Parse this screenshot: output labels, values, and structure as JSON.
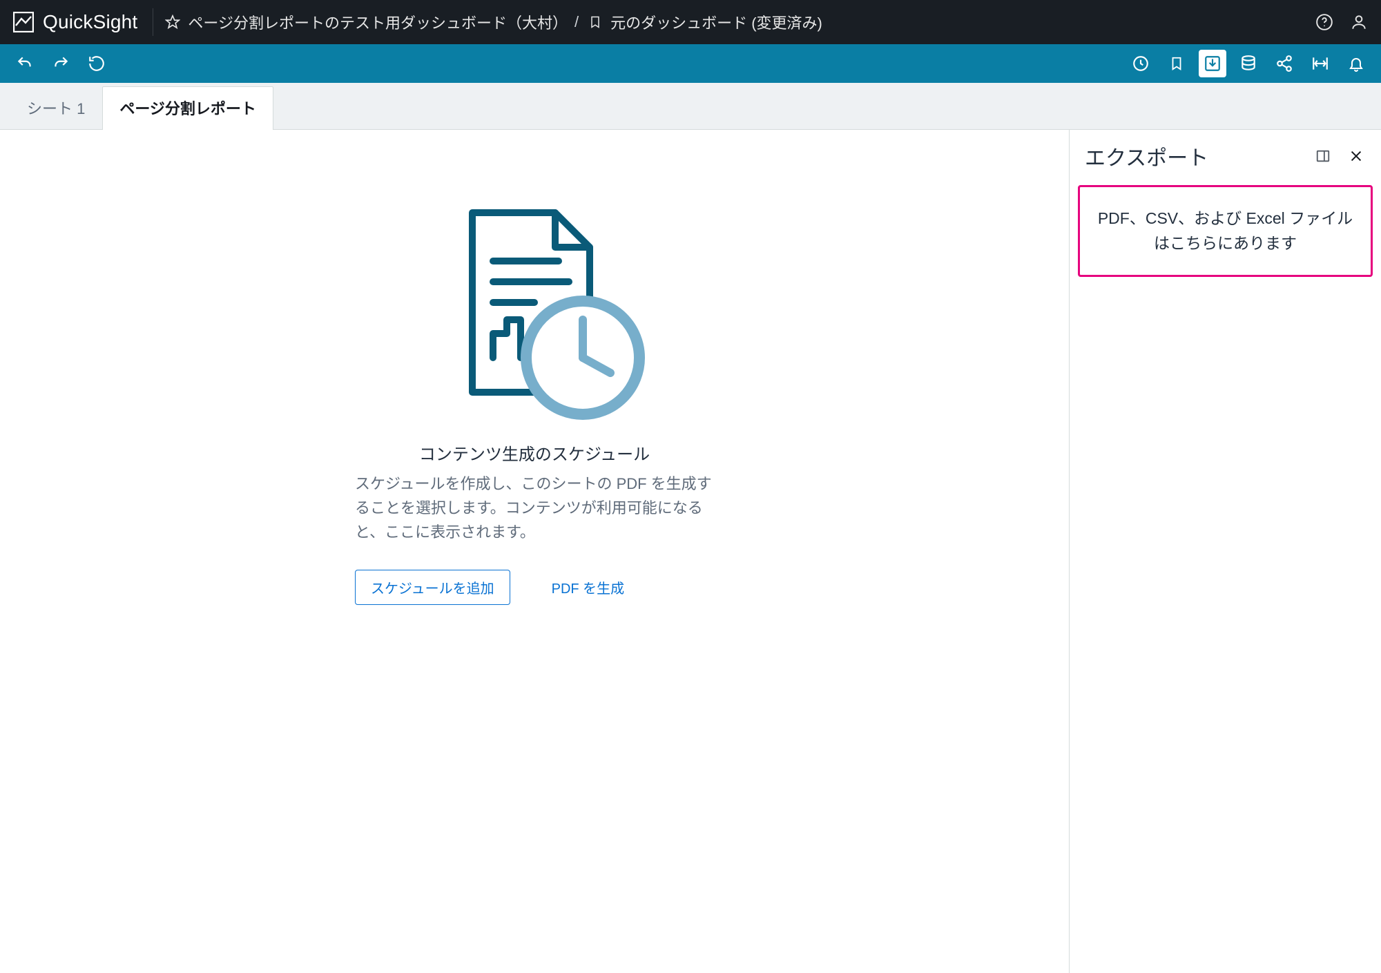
{
  "brand": {
    "name": "QuickSight"
  },
  "breadcrumb": {
    "items": [
      {
        "icon": "star-icon",
        "label": "ページ分割レポートのテスト用ダッシュボード（大村）"
      },
      {
        "icon": "bookmark-icon",
        "label": "元のダッシュボード (変更済み)"
      }
    ],
    "separator": "/"
  },
  "header_icons": {
    "help": "help-icon",
    "user": "user-icon"
  },
  "toolbar": {
    "left": [
      "undo-icon",
      "redo-icon",
      "revert-icon"
    ],
    "right": [
      {
        "name": "recent-icon",
        "active": false
      },
      {
        "name": "bookmark-icon",
        "active": false
      },
      {
        "name": "download-icon",
        "active": true
      },
      {
        "name": "database-icon",
        "active": false
      },
      {
        "name": "share-icon",
        "active": false
      },
      {
        "name": "fit-width-icon",
        "active": false
      },
      {
        "name": "notifications-icon",
        "active": false
      }
    ]
  },
  "tabs": [
    {
      "label": "シート 1",
      "active": false
    },
    {
      "label": "ページ分割レポート",
      "active": true
    }
  ],
  "empty_state": {
    "title": "コンテンツ生成のスケジュール",
    "body": "スケジュールを作成し、このシートの PDF を生成することを選択します。コンテンツが利用可能になると、ここに表示されます。",
    "add_schedule_label": "スケジュールを追加",
    "generate_pdf_label": "PDF を生成"
  },
  "side_panel": {
    "title": "エクスポート",
    "card_text": "PDF、CSV、および Excel ファイルはこちらにあります"
  }
}
